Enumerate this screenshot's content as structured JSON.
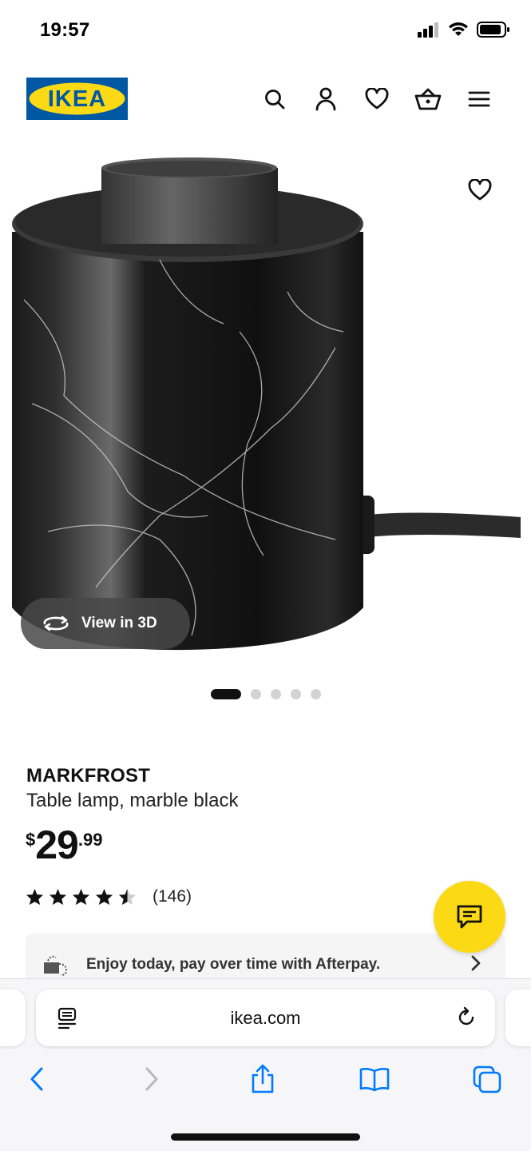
{
  "status_bar": {
    "time": "19:57"
  },
  "header": {
    "logo_text": "IKEA",
    "icons": [
      "search-icon",
      "account-icon",
      "heart-icon",
      "basket-icon",
      "menu-icon"
    ]
  },
  "product": {
    "view_3d_label": "View in 3D",
    "carousel": {
      "total": 5,
      "active": 1
    },
    "name": "MARKFROST",
    "description": "Table lamp, marble black",
    "price": {
      "currency": "$",
      "integer": "29",
      "decimal": ".99"
    },
    "rating": {
      "value": 4.5,
      "max": 5,
      "count": "(146)"
    }
  },
  "afterpay": {
    "text": "Enjoy today, pay over time with Afterpay."
  },
  "browser": {
    "url": "ikea.com"
  },
  "colors": {
    "ikea_blue": "#0058A3",
    "ikea_yellow": "#FBD914",
    "safari_blue": "#007AFF"
  }
}
